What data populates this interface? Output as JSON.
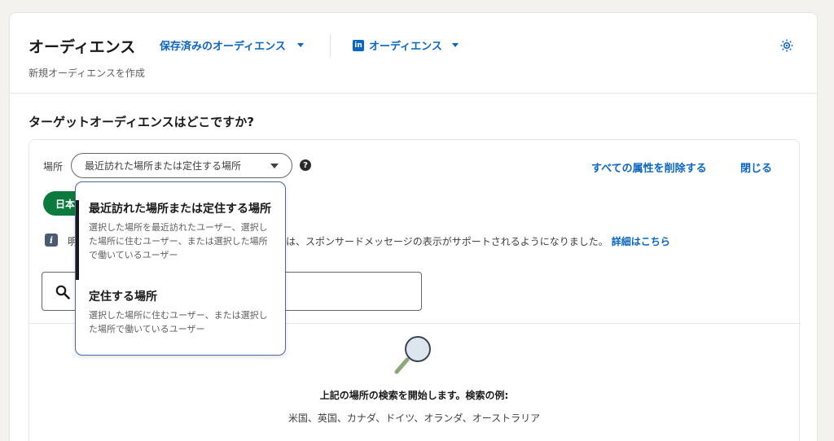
{
  "header": {
    "title": "オーディエンス",
    "saved_audiences_label": "保存済みのオーディエンス",
    "linkedin_audience_label": "オーディエンス",
    "linkedin_logo_text": "in",
    "subtitle": "新規オーディエンスを作成"
  },
  "question": "ターゲットオーディエンスはどこですか?",
  "location": {
    "label": "場所",
    "selected": "最近訪れた場所または定住する場所",
    "help_symbol": "?",
    "remove_all_label": "すべての属性を削除する",
    "close_label": "閉じる"
  },
  "selected_pill": "日本",
  "info": {
    "icon_letter": "i",
    "text_start": "明",
    "text_end": "は、スポンサードメッセージの表示がサポートされるようになりました。",
    "link": "詳細はこちら"
  },
  "search": {
    "empty_title": "上記の場所の検索を開始します。検索の例:",
    "examples": "米国、英国、カナダ、ドイツ、オランダ、オーストラリア"
  },
  "dropdown": {
    "items": [
      {
        "title": "最近訪れた場所または定住する場所",
        "description": "選択した場所を最近訪れたユーザー、選択した場所に住むユーザー、または選択した場所で働いているユーザー",
        "selected": true
      },
      {
        "title": "定住する場所",
        "description": "選択した場所に住むユーザー、または選択した場所で働いているユーザー",
        "selected": false
      }
    ]
  },
  "colors": {
    "accent": "#0a66c2",
    "pill": "#0d7a3d",
    "dropdown_border": "#4a6a9b"
  }
}
